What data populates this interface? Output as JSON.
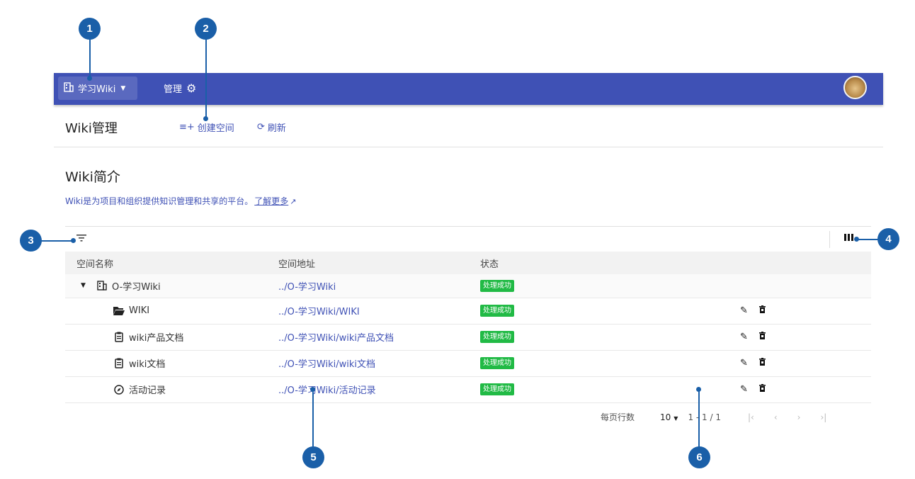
{
  "markers": [
    "1",
    "2",
    "3",
    "4",
    "5",
    "6"
  ],
  "topbar": {
    "workspace_label": "学习Wiki",
    "workspace_icon": "building-icon",
    "admin_label": "管理",
    "admin_icon": "gear-icon",
    "avatar": "user-avatar",
    "bg_color": "#3f51b5"
  },
  "toolbar": {
    "page_title": "Wiki管理",
    "create_label": "创建空间",
    "refresh_label": "刷新"
  },
  "intro": {
    "title": "Wiki简介",
    "description": "Wiki是为项目和组织提供知识管理和共享的平台。",
    "learn_more": "了解更多"
  },
  "table": {
    "headers": [
      "空间名称",
      "空间地址",
      "状态"
    ],
    "rows": [
      {
        "name": "O-学习Wiki",
        "icon": "building-icon",
        "address": "../O-学习Wiki",
        "status": "处理成功"
      },
      {
        "name": "WIKI",
        "icon": "folder-open-icon",
        "address": "../O-学习Wiki/WIKI",
        "status": "处理成功"
      },
      {
        "name": "wiki产品文档",
        "icon": "clipboard-icon",
        "address": "../O-学习Wiki/wiki产品文档",
        "status": "处理成功"
      },
      {
        "name": "wiki文档",
        "icon": "clipboard-icon",
        "address": "../O-学习Wiki/wiki文档",
        "status": "处理成功"
      },
      {
        "name": "活动记录",
        "icon": "compass-icon",
        "address": "../O-学习Wiki/活动记录",
        "status": "处理成功"
      }
    ]
  },
  "pagination": {
    "rows_per_page_label": "每页行数",
    "rows_per_page": "10",
    "range": "1 - 1 / 1"
  },
  "colors": {
    "accent": "#3f51b5",
    "success": "#21ba45",
    "marker": "#1a5fa8"
  }
}
